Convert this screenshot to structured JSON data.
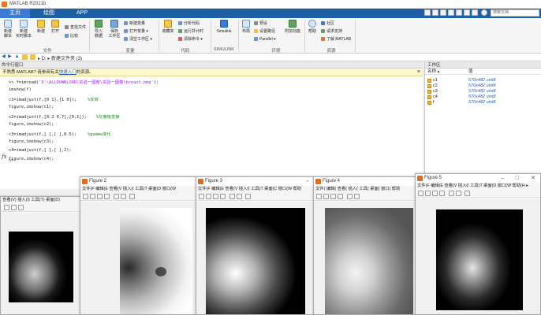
{
  "window": {
    "title": "MATLAB R2021b",
    "search_placeholder": "搜索文档"
  },
  "tabs": [
    "主页",
    "绘图",
    "APP"
  ],
  "ribbon": {
    "buttons": [
      "新建\n脚本",
      "新建\n实时脚本",
      "新建",
      "打开",
      "导入\n数据",
      "保存\n工作区",
      "收藏夹",
      "Simulink",
      "布局",
      "附加功能",
      "帮助"
    ],
    "small": {
      "find_files": "查找文件",
      "compare": "比较",
      "new_variable": "新建变量",
      "open_variable": "打开变量 ▾",
      "clear_workspace": "清空工作区 ▾",
      "analyze_code": "分析代码",
      "run_and_time": "运行并计时",
      "clear_commands": "清除命令 ▾",
      "preferences": "预设",
      "set_path": "设置路径",
      "parallel": "Parallel ▾",
      "community": "社区",
      "request_support": "请求支持",
      "learn_matlab": "了解 MATLAB"
    },
    "groups": [
      "文件",
      "变量",
      "代码",
      "SIMULINK",
      "环境",
      "资源"
    ]
  },
  "path": {
    "text": "▸ D: ▸ 新建文件夹 (3)"
  },
  "command_window": {
    "title": "命令行窗口",
    "notice_prefix": "不熟悉 MATLAB? 请参阅有关",
    "notice_link": "快速入门",
    "notice_suffix": "的资源。",
    "lines": [
      {
        "code": ">> f=imread(",
        "str": "'D:\\ALLDOWNLOAD\\实验一图像\\实验一图像\\breast.bmp'",
        "rest": ");",
        "cmt": ""
      },
      {
        "code": "imshow(f)",
        "str": "",
        "rest": "",
        "cmt": ""
      },
      {
        "code": "c1=imadjust(f,[0 1],[1 0]);",
        "str": "",
        "rest": "",
        "cmt": "%反转"
      },
      {
        "code": "figure,imshow(c1);",
        "str": "",
        "rest": "",
        "cmt": ""
      },
      {
        "code": "c2=imadjust(f,[0.2 0.7],[0,1]);",
        "str": "",
        "rest": "",
        "cmt": "%灰度级变换"
      },
      {
        "code": "figure,imshow(c2);",
        "str": "",
        "rest": "",
        "cmt": ""
      },
      {
        "code": "c3=imadjust(f,[ ],[ ],0.5);",
        "str": "",
        "rest": "",
        "cmt": "%gamma变化"
      },
      {
        "code": "figure,imshow(c3);",
        "str": "",
        "rest": "",
        "cmt": ""
      },
      {
        "code": "c4=imadjust(f,[ ],[ ],2);",
        "str": "",
        "rest": "",
        "cmt": ""
      },
      {
        "code": "figure,imshow(c4);",
        "str": "",
        "rest": "",
        "cmt": ""
      }
    ],
    "prompt": ">>",
    "fx": "fx"
  },
  "workspace": {
    "title": "工作区",
    "col_name": "名称 ▴",
    "col_value": "值",
    "vars": [
      {
        "name": "c1",
        "value": "570x482 uint8"
      },
      {
        "name": "c2",
        "value": "570x482 uint8"
      },
      {
        "name": "c3",
        "value": "570x482 uint8"
      },
      {
        "name": "c4",
        "value": "570x482 uint8"
      },
      {
        "name": "f",
        "value": "570x482 uint8"
      }
    ]
  },
  "figures": [
    {
      "title": "",
      "menu": "查看(V)  插入(I)  工具(T)  桌面(D)"
    },
    {
      "title": "Figure 2",
      "menu": "文件(F  编辑(E  查看(V  插入(I  工具(T  桌面(D  窗口(W"
    },
    {
      "title": "Figure 3",
      "menu": "文件(F  编辑(E  查看(V  插入(I  工具(T  桌面(C  窗口(W  帮助"
    },
    {
      "title": "Figure 4",
      "menu": "文件(  编辑(  查看(  插入(  工具(  桌面(  窗口(  帮助"
    },
    {
      "title": "Figure 5",
      "menu": "文件(F  编辑(E  查看(V  插入(I  工具(T  桌面(D  窗口(W  帮助(H ▸"
    }
  ],
  "colors": {
    "tab_bar": "#1f5fa6",
    "notice": "#fff8cc",
    "string": "#a020f0",
    "comment": "#228b22"
  }
}
